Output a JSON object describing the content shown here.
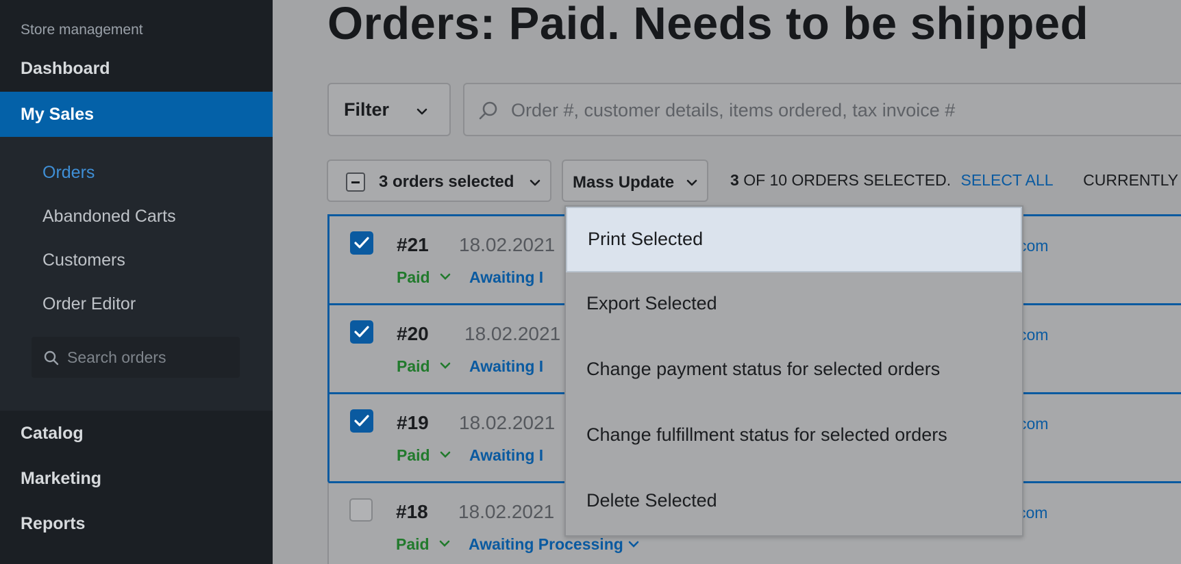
{
  "sidebar": {
    "section_title": "Store management",
    "dashboard": "Dashboard",
    "active": "My Sales",
    "subitems": [
      "Orders",
      "Abandoned Carts",
      "Customers",
      "Order Editor"
    ],
    "search_placeholder": "Search orders",
    "bottom": [
      "Catalog",
      "Marketing",
      "Reports"
    ]
  },
  "main": {
    "title": "Orders: Paid. Needs to be shipped",
    "filter_label": "Filter",
    "search_placeholder": "Order #, customer details, items ordered, tax invoice #",
    "selection_button": "3 orders selected",
    "mass_update": "Mass Update",
    "selection_info": {
      "count": "3",
      "text": "OF 10 ORDERS SELECTED.",
      "select_all": "SELECT ALL",
      "currently": "CURRENTLY"
    }
  },
  "orders": [
    {
      "number": "#21",
      "date": "18.02.2021",
      "payment": "Paid",
      "fulfillment": "Awaiting I",
      "email": "com",
      "checked": true
    },
    {
      "number": "#20",
      "date": "18.02.2021",
      "payment": "Paid",
      "fulfillment": "Awaiting I",
      "email": "com",
      "checked": true
    },
    {
      "number": "#19",
      "date": "18.02.2021",
      "payment": "Paid",
      "fulfillment": "Awaiting I",
      "email": "com",
      "checked": true
    },
    {
      "number": "#18",
      "date": "18.02.2021",
      "payment": "Paid",
      "fulfillment": "Awaiting Processing",
      "email": "com",
      "checked": false
    }
  ],
  "mass_update_menu": [
    "Print Selected",
    "Export Selected",
    "Change payment status for selected orders",
    "Change fulfillment status for selected orders",
    "Delete Selected"
  ],
  "colors": {
    "accent": "#0461a8",
    "link": "#0a5aa0",
    "paid": "#217a2c",
    "sidebar_bg": "#1b1f24"
  }
}
